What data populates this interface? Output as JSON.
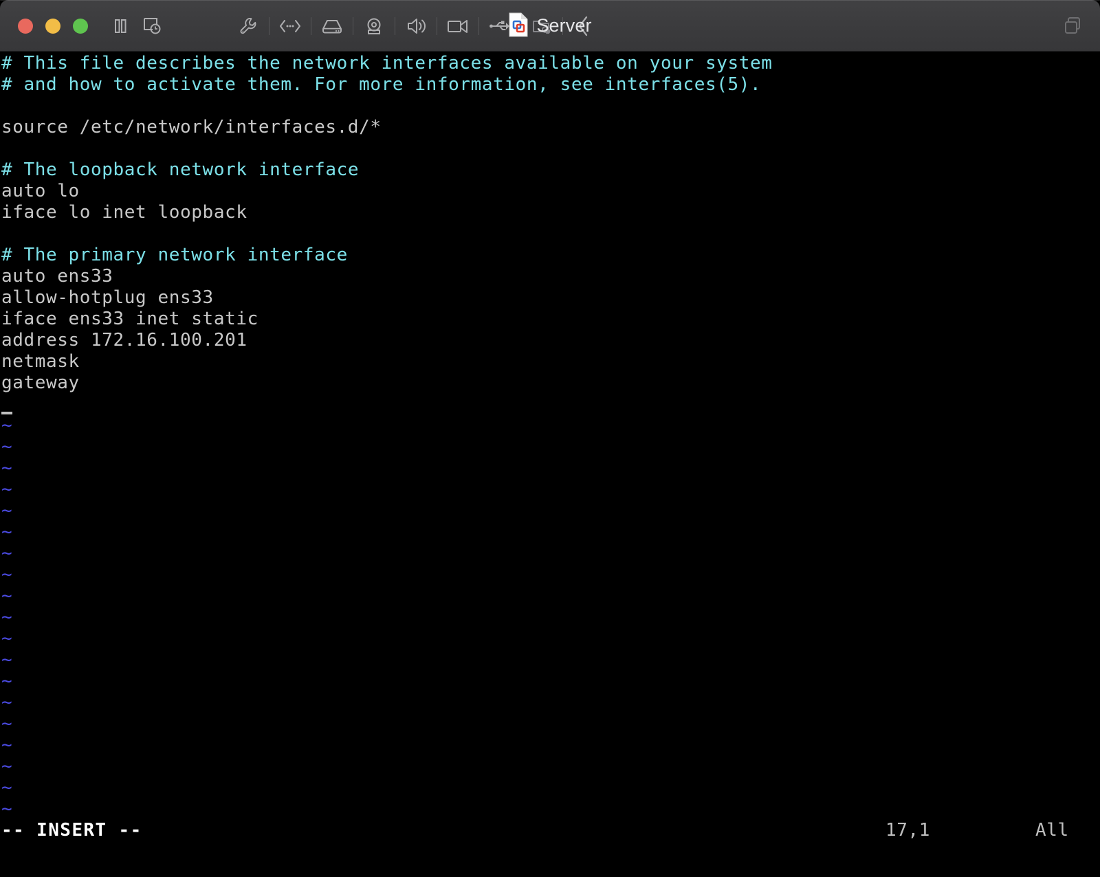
{
  "window": {
    "title": "Server",
    "app_icon": "vm-document-icon",
    "traffic_lights": [
      {
        "name": "close-button",
        "color": "#e9695e"
      },
      {
        "name": "minimize-button",
        "color": "#f2bd47"
      },
      {
        "name": "maximize-button",
        "color": "#5fc44f"
      }
    ]
  },
  "toolbar": {
    "left_icons": [
      {
        "name": "pause-icon",
        "label": "Pause"
      },
      {
        "name": "snapshot-icon",
        "label": "Snapshot"
      }
    ],
    "center_icons": [
      {
        "name": "wrench-icon",
        "label": "Settings"
      },
      {
        "name": "network-icon",
        "label": "Network Adapter"
      },
      {
        "name": "hard-disk-icon",
        "label": "Hard Disk"
      },
      {
        "name": "camera-icon",
        "label": "Camera"
      },
      {
        "name": "sound-icon",
        "label": "Sound Card"
      },
      {
        "name": "video-camera-icon",
        "label": "Video Camera"
      },
      {
        "name": "usb-icon",
        "label": "USB Device"
      },
      {
        "name": "shared-printer-icon",
        "label": "Printer"
      },
      {
        "name": "back-chevron-icon",
        "label": "Back"
      }
    ],
    "right_icons": [
      {
        "name": "unity-windows-icon",
        "label": "Unity View"
      }
    ]
  },
  "terminal": {
    "editor": "vim",
    "background": "#000000",
    "colors": {
      "comment": "#7ce0e8",
      "text": "#c8c8c8",
      "tilde": "#4a4ae0",
      "status": "#bfbfbf",
      "mode": "#ffffff"
    },
    "lines": [
      {
        "text": "# This file describes the network interfaces available on your system",
        "style": "comment"
      },
      {
        "text": "# and how to activate them. For more information, see interfaces(5).",
        "style": "comment"
      },
      {
        "text": "",
        "style": "text"
      },
      {
        "text": "source /etc/network/interfaces.d/*",
        "style": "text"
      },
      {
        "text": "",
        "style": "text"
      },
      {
        "text": "# The loopback network interface",
        "style": "comment"
      },
      {
        "text": "auto lo",
        "style": "text"
      },
      {
        "text": "iface lo inet loopback",
        "style": "text"
      },
      {
        "text": "",
        "style": "text"
      },
      {
        "text": "# The primary network interface",
        "style": "comment"
      },
      {
        "text": "auto ens33",
        "style": "text"
      },
      {
        "text": "allow-hotplug ens33",
        "style": "text"
      },
      {
        "text": "iface ens33 inet static",
        "style": "text"
      },
      {
        "text": "address 172.16.100.201",
        "style": "text"
      },
      {
        "text": "netmask",
        "style": "text"
      },
      {
        "text": "gateway",
        "style": "text"
      },
      {
        "text": "",
        "style": "text"
      }
    ],
    "empty_marker": "~",
    "empty_marker_count": 19,
    "status": {
      "mode": "-- INSERT --",
      "position": "17,1",
      "scroll": "All"
    }
  }
}
